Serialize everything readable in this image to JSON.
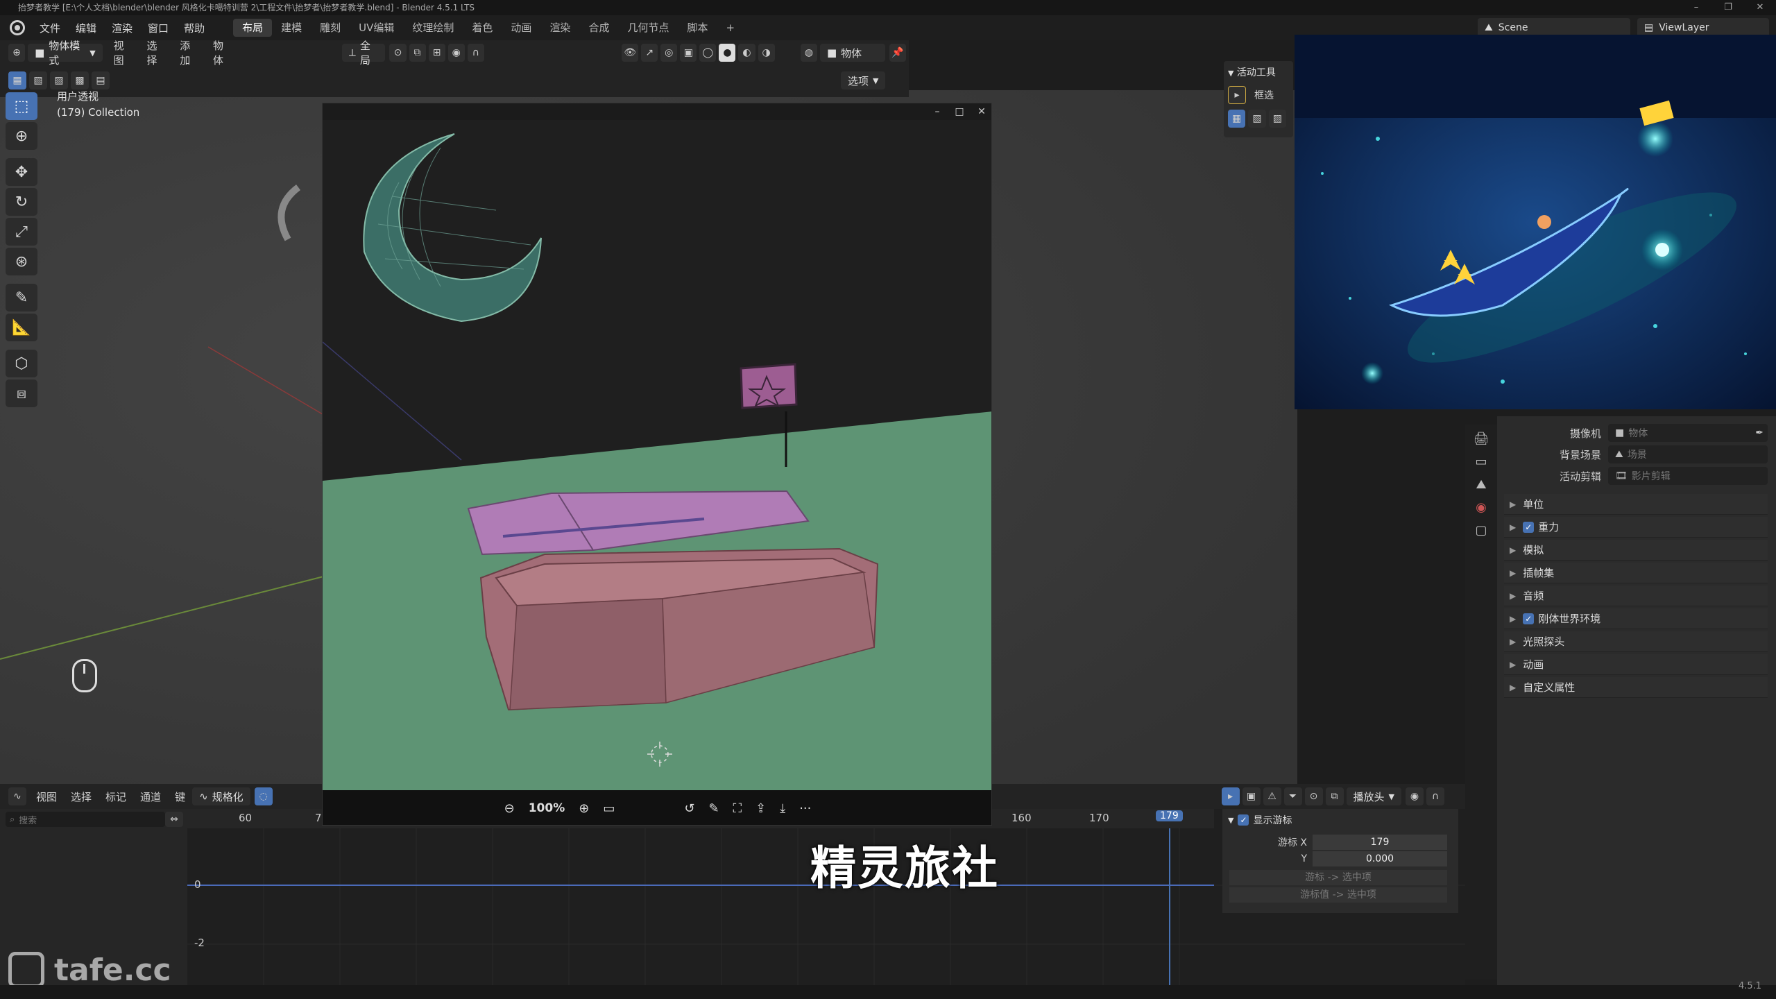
{
  "titlebar": {
    "title": "抬梦者教学 [E:\\个人文档\\blender\\blender 风格化卡噶特训营 2\\工程文件\\抬梦者\\抬梦者教学.blend] - Blender 4.5.1 LTS"
  },
  "menu": [
    "文件",
    "编辑",
    "渲染",
    "窗口",
    "帮助"
  ],
  "workspaces": [
    "布局",
    "建模",
    "雕刻",
    "UV编辑",
    "纹理绘制",
    "着色",
    "动画",
    "渲染",
    "合成",
    "几何节点",
    "脚本"
  ],
  "workspace_add": "+",
  "scene": {
    "name": "Scene",
    "view_layer": "ViewLayer"
  },
  "viewport_header": {
    "mode": "物体模式",
    "menus": [
      "视图",
      "选择",
      "添加",
      "物体"
    ],
    "transform": "全局",
    "options_label": "选项",
    "object_label": "物体"
  },
  "viewport_info": {
    "line1": "用户透视",
    "line2": "(179) Collection"
  },
  "active_tool": {
    "header": "活动工具",
    "tool_name": "框选"
  },
  "image_viewer": {
    "zoom": "100%",
    "min_btn": "–",
    "max_btn": "□",
    "close_btn": "✕",
    "more": "···"
  },
  "properties": {
    "fields": [
      {
        "label": "摄像机",
        "placeholder": "物体"
      },
      {
        "label": "背景场景",
        "placeholder": "场景"
      },
      {
        "label": "活动剪辑",
        "placeholder": "影片剪辑"
      }
    ],
    "sections": [
      {
        "label": "单位",
        "checked": false
      },
      {
        "label": "重力",
        "checked": true
      },
      {
        "label": "模拟",
        "checked": false
      },
      {
        "label": "插帧集",
        "checked": false
      },
      {
        "label": "音频",
        "checked": false
      },
      {
        "label": "刚体世界环境",
        "checked": true
      },
      {
        "label": "光照探头",
        "checked": false
      },
      {
        "label": "动画",
        "checked": false
      },
      {
        "label": "自定义属性",
        "checked": false
      }
    ]
  },
  "timeline": {
    "menus": [
      "视图",
      "选择",
      "标记",
      "通道",
      "键"
    ],
    "normalize": "规格化",
    "search_placeholder": "搜索",
    "playback": "播放头",
    "ruler_ticks": [
      "60",
      "7",
      "160",
      "170"
    ],
    "current_frame": "179",
    "y_labels": [
      "0",
      "-2"
    ]
  },
  "cursor_panel": {
    "header": "显示游标",
    "cursor_x_label": "游标 X",
    "cursor_x": "179",
    "y_label": "Y",
    "y_value": "0.000",
    "btn1": "游标 -> 选中项",
    "btn2": "游标值 -> 选中项"
  },
  "subtitle": "精灵旅社",
  "watermark": "tafe.cc",
  "version": "4.5.1"
}
